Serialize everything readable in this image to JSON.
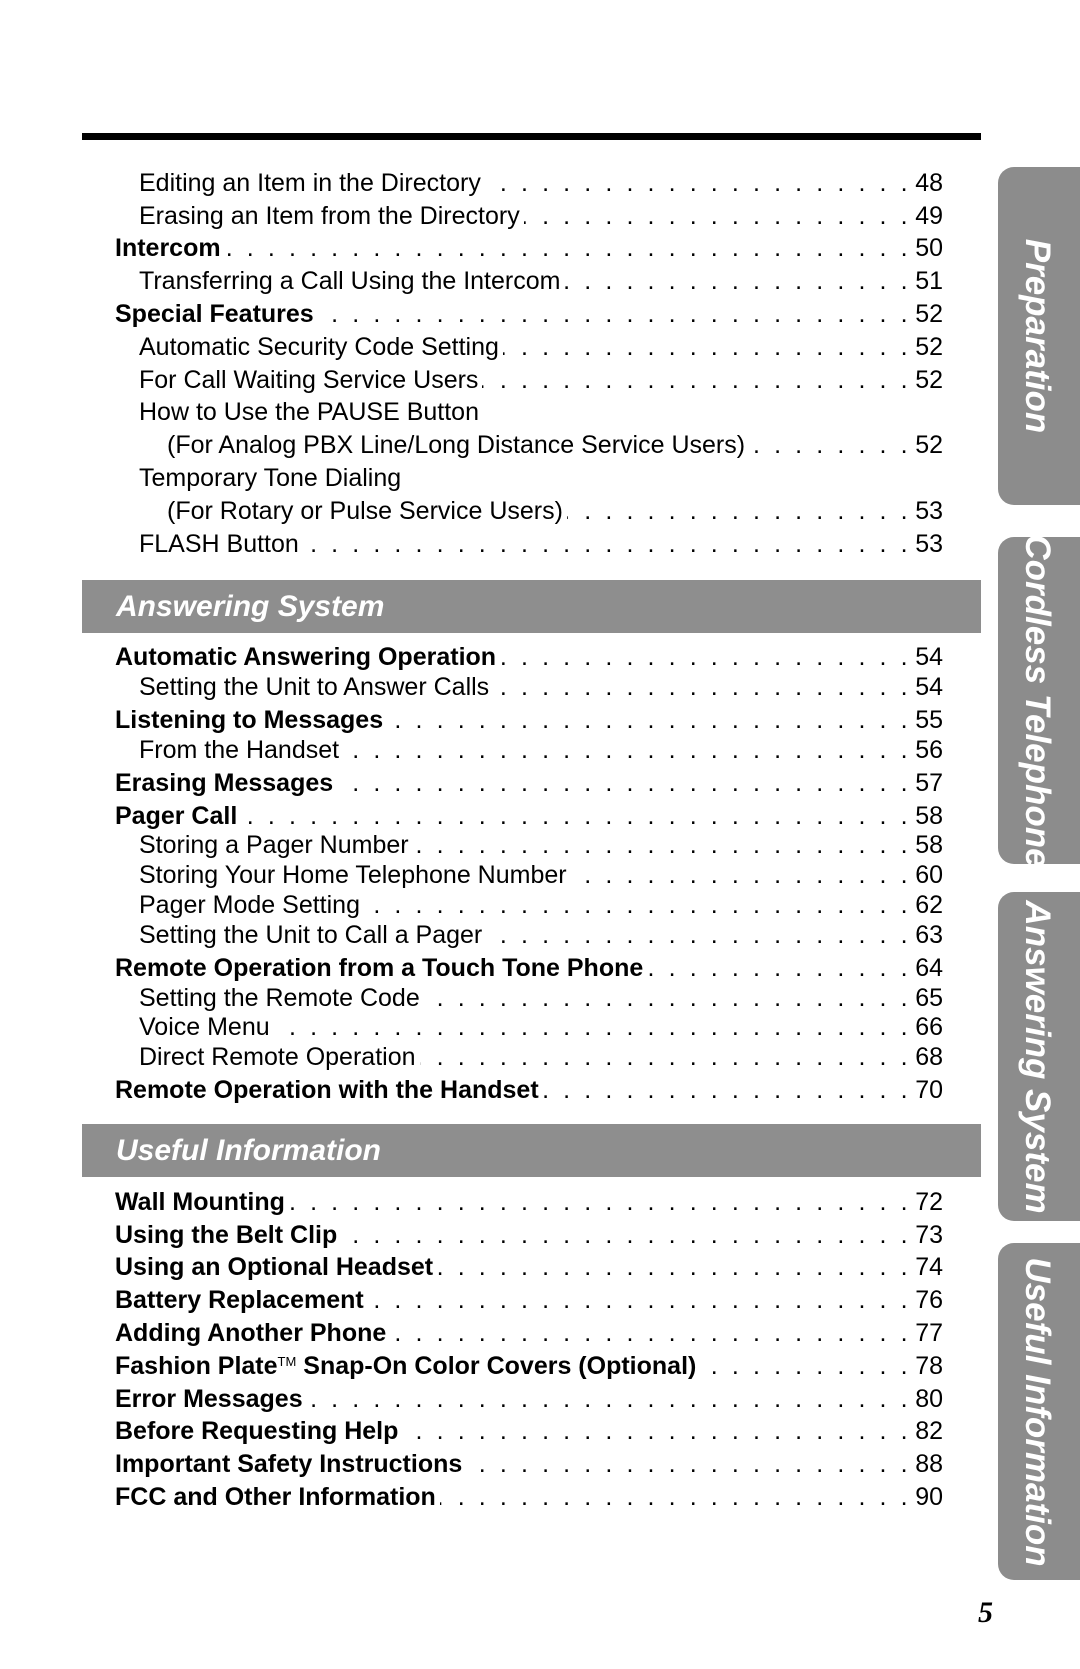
{
  "sections": [
    {
      "entries": [
        {
          "label": "Editing an Item in the Directory",
          "page": "48",
          "level": 1,
          "bold": false
        },
        {
          "label": "Erasing an Item from the Directory",
          "page": "49",
          "level": 1,
          "bold": false
        },
        {
          "label": "Intercom",
          "page": "50",
          "level": 0,
          "bold": true
        },
        {
          "label": "Transferring a Call Using the Intercom",
          "page": "51",
          "level": 1,
          "bold": false
        },
        {
          "label": "Special Features",
          "page": "52",
          "level": 0,
          "bold": true
        },
        {
          "label": "Automatic Security Code Setting",
          "page": "52",
          "level": 1,
          "bold": false
        },
        {
          "label": "For Call Waiting Service Users",
          "page": "52",
          "level": 1,
          "bold": false
        },
        {
          "label": "How to Use the PAUSE Button",
          "page": "",
          "level": 1,
          "bold": false
        },
        {
          "label": "(For Analog PBX Line/Long Distance Service Users)",
          "page": "52",
          "level": 2,
          "bold": false
        },
        {
          "label": "Temporary Tone Dialing",
          "page": "",
          "level": 1,
          "bold": false
        },
        {
          "label": "(For Rotary or Pulse Service Users)",
          "page": "53",
          "level": 2,
          "bold": false
        },
        {
          "label": "FLASH Button",
          "page": "53",
          "level": 1,
          "bold": false
        }
      ]
    },
    {
      "heading": "Answering System",
      "entries": [
        {
          "label": "Automatic Answering Operation",
          "page": "54",
          "level": 0,
          "bold": true
        },
        {
          "label": "Setting the Unit to Answer Calls",
          "page": "54",
          "level": 1,
          "bold": false
        },
        {
          "label": "Listening to Messages",
          "page": "55",
          "level": 0,
          "bold": true
        },
        {
          "label": "From the Handset",
          "page": "56",
          "level": 1,
          "bold": false
        },
        {
          "label": "Erasing Messages",
          "page": "57",
          "level": 0,
          "bold": true
        },
        {
          "label": "Pager Call",
          "page": "58",
          "level": 0,
          "bold": true
        },
        {
          "label": "Storing a Pager Number",
          "page": "58",
          "level": 1,
          "bold": false
        },
        {
          "label": "Storing Your Home Telephone Number",
          "page": "60",
          "level": 1,
          "bold": false
        },
        {
          "label": "Pager Mode Setting",
          "page": "62",
          "level": 1,
          "bold": false
        },
        {
          "label": "Setting the Unit to Call a Pager",
          "page": "63",
          "level": 1,
          "bold": false
        },
        {
          "label": "Remote Operation from a Touch Tone Phone",
          "page": "64",
          "level": 0,
          "bold": true
        },
        {
          "label": "Setting the Remote Code",
          "page": "65",
          "level": 1,
          "bold": false
        },
        {
          "label": "Voice Menu",
          "page": "66",
          "level": 1,
          "bold": false
        },
        {
          "label": "Direct Remote Operation",
          "page": "68",
          "level": 1,
          "bold": false
        },
        {
          "label": "Remote Operation with the Handset",
          "page": "70",
          "level": 0,
          "bold": true
        }
      ]
    },
    {
      "heading": "Useful Information",
      "entries": [
        {
          "label": "Wall Mounting",
          "page": "72",
          "level": 0,
          "bold": true
        },
        {
          "label": "Using the Belt Clip",
          "page": "73",
          "level": 0,
          "bold": true
        },
        {
          "label": "Using an Optional Headset",
          "page": "74",
          "level": 0,
          "bold": true
        },
        {
          "label": "Battery Replacement",
          "page": "76",
          "level": 0,
          "bold": true
        },
        {
          "label": "Adding Another Phone",
          "page": "77",
          "level": 0,
          "bold": true
        },
        {
          "label": "Fashion Plate™ Snap-On Color Covers (Optional)",
          "page": "78",
          "level": 0,
          "bold": true
        },
        {
          "label": "Error Messages",
          "page": "80",
          "level": 0,
          "bold": true
        },
        {
          "label": "Before Requesting Help",
          "page": "82",
          "level": 0,
          "bold": true
        },
        {
          "label": "Important Safety Instructions",
          "page": "88",
          "level": 0,
          "bold": true
        },
        {
          "label": "FCC and Other Information",
          "page": "90",
          "level": 0,
          "bold": true
        }
      ]
    }
  ],
  "tabs": [
    "Preparation",
    "Cordless Telephone",
    "Answering System",
    "Useful Information"
  ],
  "page_number": "5",
  "colors": {
    "header_bg": "#8e8e8e",
    "tab_bg": "#8c8c8c",
    "rule": "#000000"
  }
}
